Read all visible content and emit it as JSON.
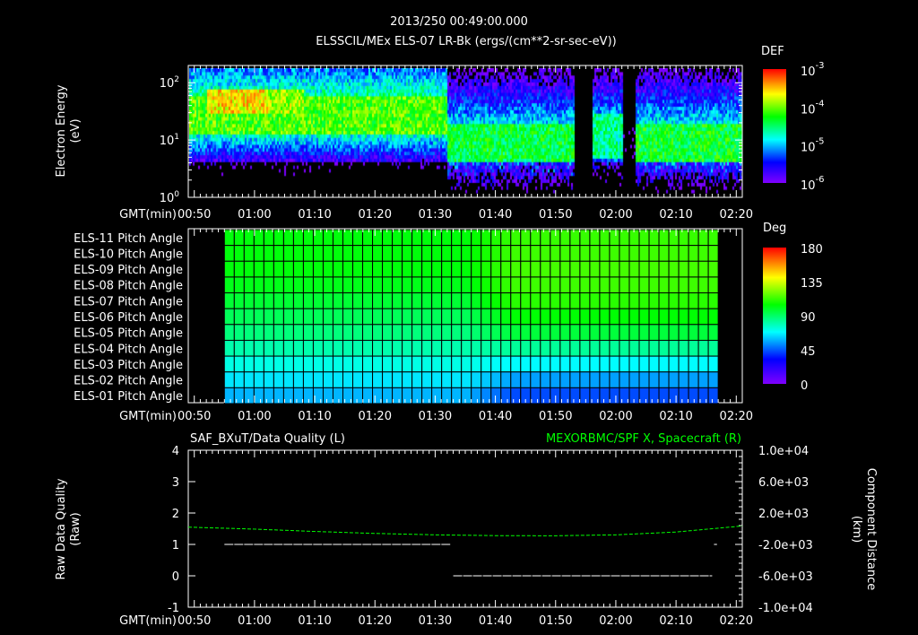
{
  "header": {
    "datetime": "2013/250 00:49:00.000",
    "subtitle": "ELSSCIL/MEx ELS-07 LR-Bk  (ergs/(cm**2-sr-sec-eV))"
  },
  "time_axis": {
    "label": "GMT(min)",
    "ticks": [
      "00:50",
      "01:00",
      "01:10",
      "01:20",
      "01:30",
      "01:40",
      "01:50",
      "02:00",
      "02:10",
      "02:20"
    ],
    "tick_minutes": [
      50,
      60,
      70,
      80,
      90,
      100,
      110,
      120,
      130,
      140
    ],
    "range_minutes": [
      49,
      141
    ]
  },
  "chart_data": [
    {
      "type": "heatmap",
      "name": "spectrogram",
      "ylabel_line1": "Electron Energy",
      "ylabel_line2": "(eV)",
      "yscale": "log",
      "ylim": [
        1,
        200
      ],
      "yticks": [
        {
          "base": "10",
          "exp": "0",
          "value": 1
        },
        {
          "base": "10",
          "exp": "1",
          "value": 10
        },
        {
          "base": "10",
          "exp": "2",
          "value": 100
        }
      ],
      "colorbar": {
        "title": "DEF",
        "scale": "log",
        "range": [
          -6,
          -3
        ],
        "ticks": [
          {
            "base": "10",
            "exp": "-3"
          },
          {
            "base": "10",
            "exp": "-4"
          },
          {
            "base": "10",
            "exp": "-5"
          },
          {
            "base": "10",
            "exp": "-6"
          }
        ]
      },
      "segments": [
        {
          "start": 49,
          "end": 91,
          "band_eV": [
            13,
            60
          ],
          "log_def": -4.1,
          "peak_eV": [
            30,
            80
          ],
          "peak_time": [
            55,
            62
          ],
          "peak_log_def": -3.6
        },
        {
          "start": 92,
          "end": 113,
          "band_eV": [
            4,
            20
          ],
          "log_def": -4.4
        },
        {
          "start": 113,
          "end": 116,
          "band_eV": [
            4,
            20
          ],
          "log_def": -6.5
        },
        {
          "start": 116,
          "end": 121,
          "band_eV": [
            5,
            30
          ],
          "log_def": -4.6
        },
        {
          "start": 121,
          "end": 123,
          "band_eV": [
            4,
            20
          ],
          "log_def": -6.3
        },
        {
          "start": 123,
          "end": 141,
          "band_eV": [
            4,
            20
          ],
          "log_def": -4.35
        }
      ]
    },
    {
      "type": "heatmap",
      "name": "pitch-angle",
      "rows": [
        "ELS-11 Pitch Angle",
        "ELS-10 Pitch Angle",
        "ELS-09 Pitch Angle",
        "ELS-08 Pitch Angle",
        "ELS-07 Pitch Angle",
        "ELS-06 Pitch Angle",
        "ELS-05 Pitch Angle",
        "ELS-04 Pitch Angle",
        "ELS-03 Pitch Angle",
        "ELS-02 Pitch Angle",
        "ELS-01 Pitch Angle"
      ],
      "time_range": [
        55,
        137
      ],
      "columns": 50,
      "transition_minutes": [
        95,
        103
      ],
      "values_before_deg": [
        103,
        103,
        103,
        101,
        97,
        92,
        87,
        80,
        72,
        65,
        58
      ],
      "values_after_deg": [
        112,
        113,
        114,
        113,
        110,
        104,
        96,
        83,
        68,
        55,
        43
      ],
      "colorbar": {
        "title": "Deg",
        "range": [
          0,
          180
        ],
        "ticks": [
          "180",
          "135",
          "90",
          "45",
          "0"
        ]
      }
    },
    {
      "type": "line",
      "name": "data-quality",
      "title_left": "SAF_BXuT/Data Quality (L)",
      "title_right": "MEXORBMC/SPF X, Spacecraft (R)",
      "ylabel_left_line1": "Raw  Data  Quality",
      "ylabel_left_line2": "(Raw)",
      "ylabel_right_line1": "Component Distance",
      "ylabel_right_line2": "(km)",
      "ylim_left": [
        -1,
        4
      ],
      "yticks_left": [
        "4",
        "3",
        "2",
        "1",
        "0",
        "-1"
      ],
      "ylim_right": [
        -10000,
        10000
      ],
      "yticks_right": [
        "1.0e+04",
        "6.0e+03",
        "2.0e+03",
        "-2.0e+03",
        "-6.0e+03",
        "-1.0e+04"
      ],
      "series": [
        {
          "name": "Data Quality",
          "axis": "left",
          "color": "#ffffff",
          "segments": [
            {
              "start": 55,
              "end": 92.5,
              "value": 1
            },
            {
              "start": 93,
              "end": 136,
              "value": 0
            },
            {
              "start": 136.3,
              "end": 136.8,
              "value": 1
            }
          ]
        },
        {
          "name": "SPF X",
          "axis": "right",
          "color": "#00ff00",
          "x": [
            49,
            60,
            70,
            80,
            90,
            100,
            110,
            120,
            130,
            141
          ],
          "y": [
            200,
            -50,
            -350,
            -600,
            -780,
            -880,
            -900,
            -780,
            -420,
            350
          ]
        }
      ]
    }
  ]
}
